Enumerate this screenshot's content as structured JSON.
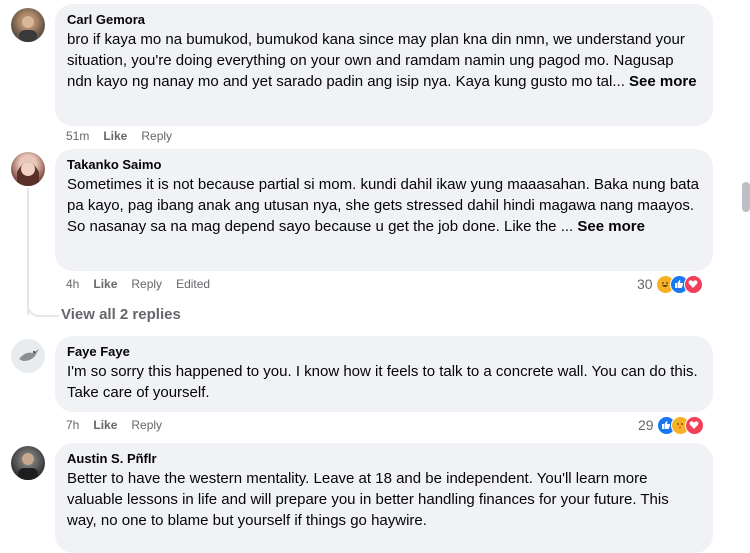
{
  "comments": [
    {
      "author": "Carl Gemora",
      "text": "bro if kaya mo na bumukod, bumukod kana since may plan kna din nmn, we understand your situation, you're doing everything on your own and ramdam namin ung pagod mo. Nagusap ndn kayo ng nanay mo and yet sarado padin ang isip nya. Kaya kung gusto mo tal...",
      "see_more": "See more",
      "time": "51m",
      "like": "Like",
      "reply": "Reply"
    },
    {
      "author": "Takanko Saimo",
      "text": "Sometimes it is not because partial si mom. kundi dahil ikaw yung maaasahan. Baka nung bata pa kayo, pag ibang anak ang utusan nya, she gets stressed dahil hindi magawa nang maayos. So nasanay sa na mag depend sayo because u get the job done. Like the ...",
      "see_more": "See more",
      "time": "4h",
      "like": "Like",
      "reply": "Reply",
      "edited": "Edited",
      "reaction_count": "30",
      "reaction_icons": [
        "haha-icon",
        "like-icon",
        "love-icon"
      ],
      "view_replies": "View all 2 replies"
    },
    {
      "author": "Faye Faye",
      "text": "I'm so sorry this happened to you. I know how it feels to talk to a concrete wall. You can do this. Take care of yourself.",
      "time": "7h",
      "like": "Like",
      "reply": "Reply",
      "reaction_count": "29",
      "reaction_icons": [
        "like-icon",
        "care-icon",
        "love-icon"
      ]
    },
    {
      "author": "Austin S. Pñflr",
      "text": "Better to have the western mentality. Leave at 18 and be independent. You'll learn more valuable lessons in life and will prepare you in better handling finances for your future. This way, no one to blame but yourself if things go haywire."
    }
  ],
  "colors": {
    "bubble": "#f0f2f5",
    "meta": "#65676b",
    "like_blue": "#1877f2",
    "love_red": "#f33e58",
    "haha_yellow": "#f7b125"
  }
}
